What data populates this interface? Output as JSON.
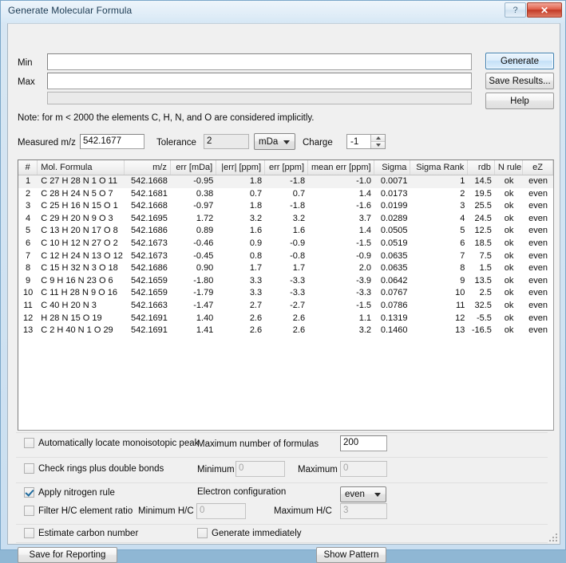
{
  "window": {
    "title": "Generate Molecular Formula",
    "help_button": "?",
    "close_button": "✕"
  },
  "range": {
    "min_label": "Min",
    "min_value": "",
    "max_label": "Max",
    "max_value": "",
    "extra_value": ""
  },
  "actions": {
    "generate": "Generate",
    "save_results": "Save Results...",
    "help": "Help"
  },
  "note": "Note: for m < 2000 the elements C, H, N, and O are considered implicitly.",
  "params": {
    "measured_mz_label": "Measured m/z",
    "measured_mz_value": "542.1677",
    "tolerance_label": "Tolerance",
    "tolerance_value": "2",
    "tolerance_unit": "mDa",
    "charge_label": "Charge",
    "charge_value": "-1"
  },
  "table": {
    "columns": [
      "#",
      "Mol. Formula",
      "m/z",
      "err [mDa]",
      "|err| [ppm]",
      "err [ppm]",
      "mean err [ppm]",
      "Sigma",
      "Sigma Rank",
      "rdb",
      "N rule",
      "eZ"
    ],
    "rows": [
      [
        "1",
        "C 27 H 28 N 1 O 11",
        "542.1668",
        "-0.95",
        "1.8",
        "-1.8",
        "-1.0",
        "0.0071",
        "1",
        "14.5",
        "ok",
        "even"
      ],
      [
        "2",
        "C 28 H 24 N 5 O 7",
        "542.1681",
        "0.38",
        "0.7",
        "0.7",
        "1.4",
        "0.0173",
        "2",
        "19.5",
        "ok",
        "even"
      ],
      [
        "3",
        "C 25 H 16 N 15 O 1",
        "542.1668",
        "-0.97",
        "1.8",
        "-1.8",
        "-1.6",
        "0.0199",
        "3",
        "25.5",
        "ok",
        "even"
      ],
      [
        "4",
        "C 29 H 20 N 9 O 3",
        "542.1695",
        "1.72",
        "3.2",
        "3.2",
        "3.7",
        "0.0289",
        "4",
        "24.5",
        "ok",
        "even"
      ],
      [
        "5",
        "C 13 H 20 N 17 O 8",
        "542.1686",
        "0.89",
        "1.6",
        "1.6",
        "1.4",
        "0.0505",
        "5",
        "12.5",
        "ok",
        "even"
      ],
      [
        "6",
        "C 10 H 12 N 27 O 2",
        "542.1673",
        "-0.46",
        "0.9",
        "-0.9",
        "-1.5",
        "0.0519",
        "6",
        "18.5",
        "ok",
        "even"
      ],
      [
        "7",
        "C 12 H 24 N 13 O 12",
        "542.1673",
        "-0.45",
        "0.8",
        "-0.8",
        "-0.9",
        "0.0635",
        "7",
        "7.5",
        "ok",
        "even"
      ],
      [
        "8",
        "C 15 H 32 N 3 O 18",
        "542.1686",
        "0.90",
        "1.7",
        "1.7",
        "2.0",
        "0.0635",
        "8",
        "1.5",
        "ok",
        "even"
      ],
      [
        "9",
        "C 9 H 16 N 23 O 6",
        "542.1659",
        "-1.80",
        "3.3",
        "-3.3",
        "-3.9",
        "0.0642",
        "9",
        "13.5",
        "ok",
        "even"
      ],
      [
        "10",
        "C 11 H 28 N 9 O 16",
        "542.1659",
        "-1.79",
        "3.3",
        "-3.3",
        "-3.3",
        "0.0767",
        "10",
        "2.5",
        "ok",
        "even"
      ],
      [
        "11",
        "C 40 H 20 N 3",
        "542.1663",
        "-1.47",
        "2.7",
        "-2.7",
        "-1.5",
        "0.0786",
        "11",
        "32.5",
        "ok",
        "even"
      ],
      [
        "12",
        "H 28 N 15 O 19",
        "542.1691",
        "1.40",
        "2.6",
        "2.6",
        "1.1",
        "0.1319",
        "12",
        "-5.5",
        "ok",
        "even"
      ],
      [
        "13",
        "C 2 H 40 N 1 O 29",
        "542.1691",
        "1.41",
        "2.6",
        "2.6",
        "3.2",
        "0.1460",
        "13",
        "-16.5",
        "ok",
        "even"
      ]
    ]
  },
  "options": {
    "auto_locate_label": "Automatically locate monoisotopic peak",
    "auto_locate_checked": false,
    "max_formulas_label": "Maximum number of formulas",
    "max_formulas_value": "200",
    "check_rdb_label": "Check rings plus double bonds",
    "check_rdb_checked": false,
    "rdb_min_label": "Minimum",
    "rdb_min_value": "0",
    "rdb_max_label": "Maximum",
    "rdb_max_value": "0",
    "nitrogen_rule_label": "Apply nitrogen rule",
    "nitrogen_rule_checked": true,
    "electron_config_label": "Electron configuration",
    "electron_config_value": "even",
    "filter_hc_label": "Filter H/C element ratio",
    "filter_hc_checked": false,
    "hc_min_label": "Minimum H/C",
    "hc_min_value": "0",
    "hc_max_label": "Maximum H/C",
    "hc_max_value": "3",
    "estimate_carbon_label": "Estimate carbon number",
    "estimate_carbon_checked": false,
    "generate_immediately_label": "Generate immediately",
    "generate_immediately_checked": false
  },
  "footer": {
    "save_for_reporting": "Save for Reporting",
    "show_pattern": "Show Pattern"
  },
  "colors": {
    "accent": "#3c7fb1",
    "close": "#c23a26",
    "check": "#1d6a9e"
  }
}
